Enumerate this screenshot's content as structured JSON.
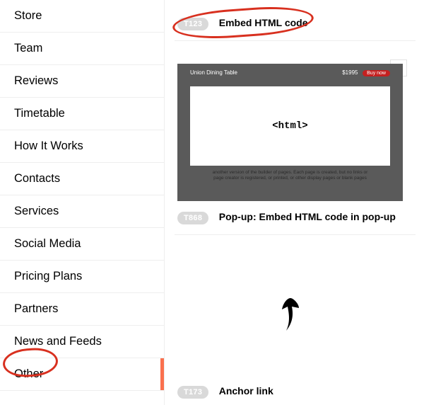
{
  "sidebar": {
    "items": [
      {
        "label": "Store"
      },
      {
        "label": "Team"
      },
      {
        "label": "Reviews"
      },
      {
        "label": "Timetable"
      },
      {
        "label": "How It Works"
      },
      {
        "label": "Contacts"
      },
      {
        "label": "Services"
      },
      {
        "label": "Social Media"
      },
      {
        "label": "Pricing Plans"
      },
      {
        "label": "Partners"
      },
      {
        "label": "News and Feeds"
      },
      {
        "label": "Other"
      }
    ],
    "active_index": 11
  },
  "blocks": [
    {
      "badge": "T123",
      "title": "Embed HTML code"
    },
    {
      "badge": "T868",
      "title": "Pop-up: Embed HTML code in pop-up"
    },
    {
      "badge": "T173",
      "title": "Anchor link"
    }
  ],
  "mockup": {
    "top_left": "Union Dining Table",
    "price": "$1995",
    "buy": "Buy now",
    "body": "<html>",
    "caption": "another version of the builder of pages. Each page is created, but no links or page creator is registered, or printed, or other display pages or blank pages"
  }
}
